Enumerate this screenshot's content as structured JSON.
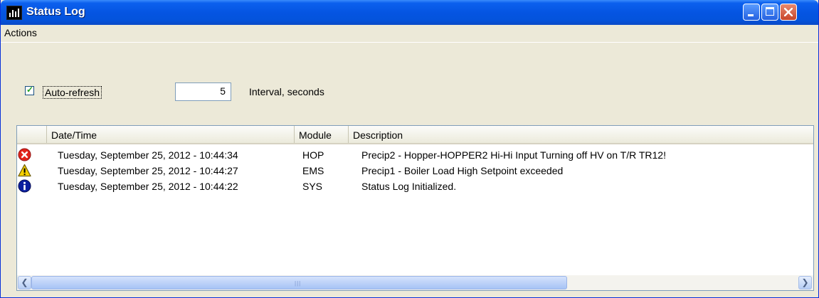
{
  "window": {
    "title": "Status Log"
  },
  "menu": {
    "items": [
      "Actions"
    ]
  },
  "controls": {
    "auto_refresh_label": "Auto-refresh",
    "auto_refresh_checked": true,
    "interval_value": "5",
    "interval_label": "Interval, seconds"
  },
  "table": {
    "columns": [
      "",
      "Date/Time",
      "Module",
      "Description"
    ],
    "rows": [
      {
        "severity_icon": "error-icon",
        "datetime": "Tuesday, September 25, 2012 - 10:44:34",
        "module": "HOP",
        "description": "Precip2 - Hopper-HOPPER2 Hi-Hi Input Turning off HV on T/R TR12!"
      },
      {
        "severity_icon": "warning-icon",
        "datetime": "Tuesday, September 25, 2012 - 10:44:27",
        "module": "EMS",
        "description": "Precip1 - Boiler Load High Setpoint exceeded"
      },
      {
        "severity_icon": "info-icon",
        "datetime": "Tuesday, September 25, 2012 - 10:44:22",
        "module": "SYS",
        "description": "Status Log Initialized."
      }
    ]
  },
  "colors": {
    "titlebar": "#0555e2",
    "error": "#e2231a",
    "warning": "#f5d000",
    "info": "#0a1e9e"
  }
}
